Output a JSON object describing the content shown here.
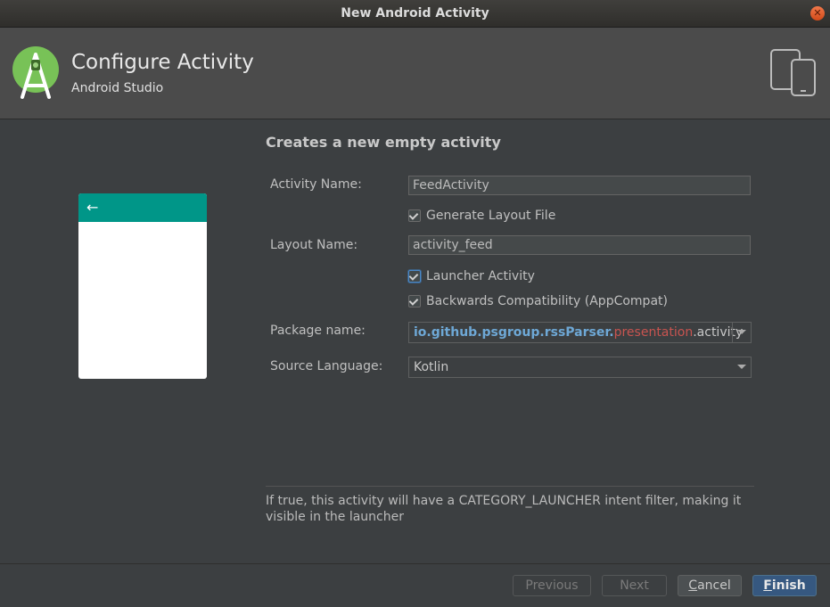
{
  "window": {
    "title": "New Android Activity"
  },
  "header": {
    "title": "Configure Activity",
    "subtitle": "Android Studio"
  },
  "form": {
    "heading": "Creates a new empty activity",
    "activity_name_label": "Activity Name:",
    "activity_name_value": "FeedActivity",
    "generate_layout_label": "Generate Layout File",
    "generate_layout_checked": true,
    "layout_name_label": "Layout Name:",
    "layout_name_value": "activity_feed",
    "launcher_label": "Launcher Activity",
    "launcher_checked": true,
    "backwards_label": "Backwards Compatibility (AppCompat)",
    "backwards_checked": true,
    "package_label": "Package name:",
    "package_part1": "io.github.psgroup.rssParser.",
    "package_part2": "presentation",
    "package_part3": ".activity",
    "language_label": "Source Language:",
    "language_value": "Kotlin"
  },
  "description": "If true, this activity will have a CATEGORY_LAUNCHER intent filter, making it visible in the launcher",
  "buttons": {
    "previous": "Previous",
    "next": "Next",
    "cancel_mnemonic": "C",
    "cancel_rest": "ancel",
    "finish_mnemonic": "F",
    "finish_rest": "inish"
  },
  "colors": {
    "accent": "#009688",
    "primary_button": "#365880",
    "package_blue": "#6ea8d6",
    "package_red": "#c75450"
  }
}
